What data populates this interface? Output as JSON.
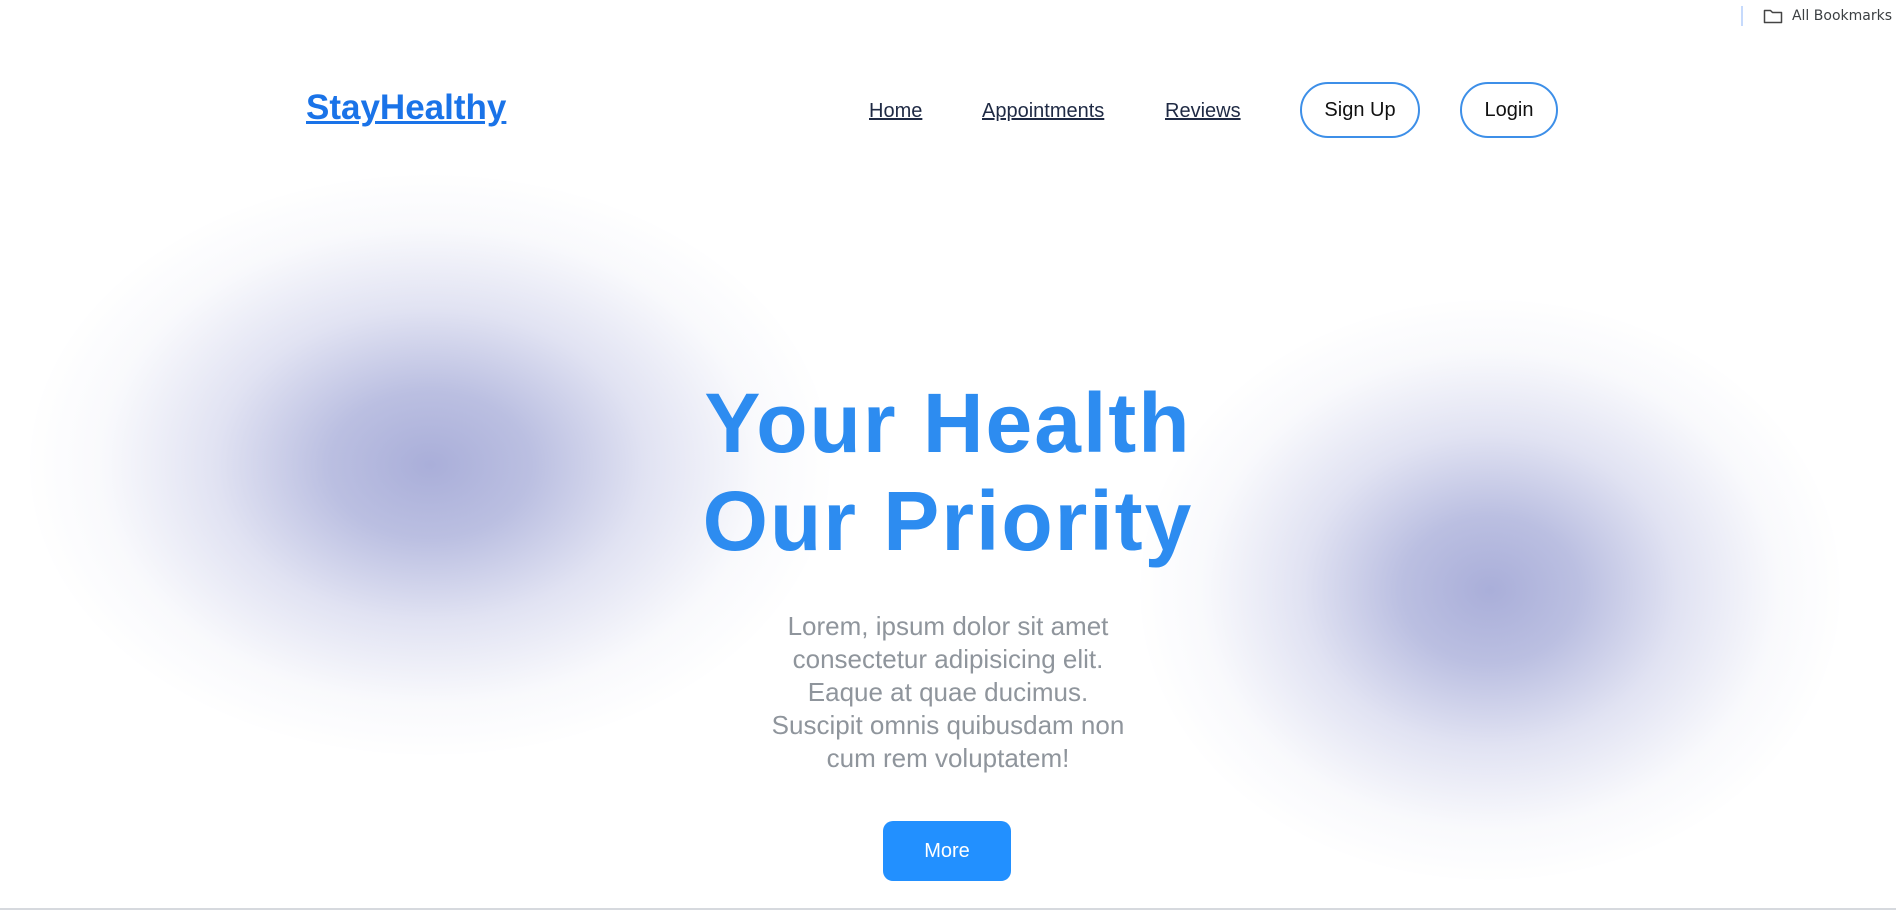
{
  "browser": {
    "bookmarks_label": "All Bookmarks",
    "bookmarks_icon": "folder-icon"
  },
  "navbar": {
    "logo": "StayHealthy",
    "links": [
      {
        "label": "Home"
      },
      {
        "label": "Appointments"
      },
      {
        "label": "Reviews"
      }
    ],
    "signup_label": "Sign Up",
    "login_label": "Login"
  },
  "hero": {
    "title_line1": "Your Health",
    "title_line2": "Our Priority",
    "description_lines": [
      "Lorem, ipsum dolor sit amet",
      "consectetur adipisicing elit.",
      "Eaque at quae ducimus.",
      "Suscipit omnis quibusdam non",
      "cum rem voluptatem!"
    ],
    "more_label": "More"
  },
  "colors": {
    "brand": "#1a73e8",
    "title": "#2d8cf0",
    "button": "#2290ff",
    "text_muted": "#8f959c",
    "blob": "#a8aed8"
  }
}
